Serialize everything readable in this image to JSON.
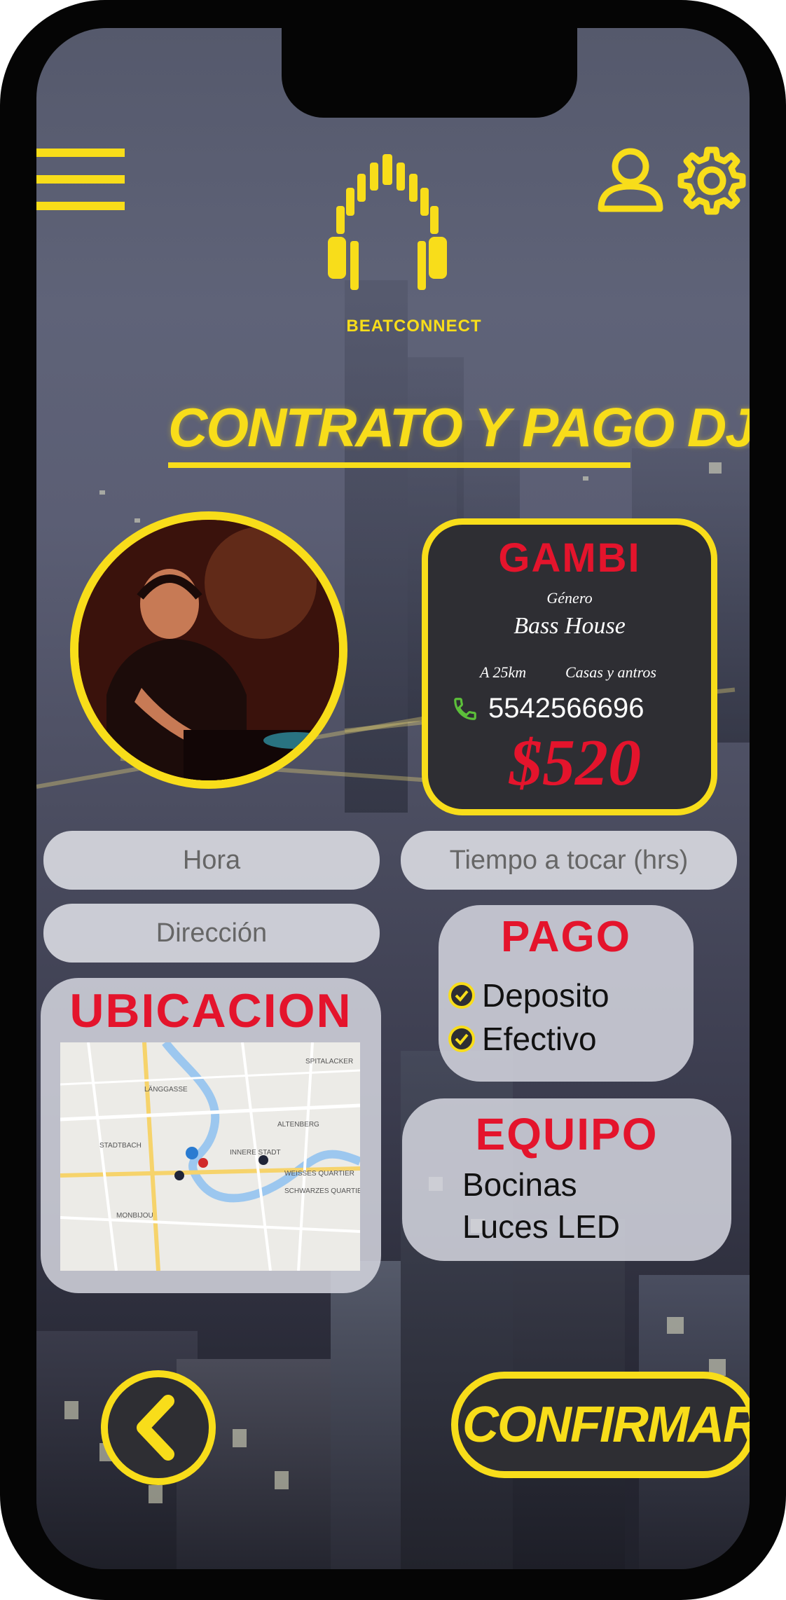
{
  "app": {
    "brand": "BEATCONNECT"
  },
  "page": {
    "title": "CONTRATO Y PAGO DJ"
  },
  "dj": {
    "name": "GAMBI",
    "genre_label": "Género",
    "genre": "Bass House",
    "distance": "A 25km",
    "venue_type": "Casas y antros",
    "phone": "5542566696",
    "price": "$520"
  },
  "form": {
    "hora_placeholder": "Hora",
    "tiempo_placeholder": "Tiempo a tocar (hrs)",
    "direccion_placeholder": "Dirección"
  },
  "ubicacion": {
    "title": "UBICACION",
    "map_labels": [
      "SPITALACKER",
      "LÄNGGASSE",
      "ALTENBERG",
      "STADTBACH",
      "INNERE STADT",
      "WEISSES QUARTIER",
      "MONBIJOU",
      "SCHWARZES QUARTIER"
    ]
  },
  "pago": {
    "title": "PAGO",
    "options": [
      {
        "label": "Deposito",
        "checked": true
      },
      {
        "label": "Efectivo",
        "checked": true
      }
    ]
  },
  "equipo": {
    "title": "EQUIPO",
    "items": [
      "Bocinas",
      "Luces LED"
    ]
  },
  "actions": {
    "confirm_label": "CONFIRMAR"
  },
  "colors": {
    "accent": "#f8dd1a",
    "red": "#e4142c",
    "card_dark": "#2e2e33"
  }
}
